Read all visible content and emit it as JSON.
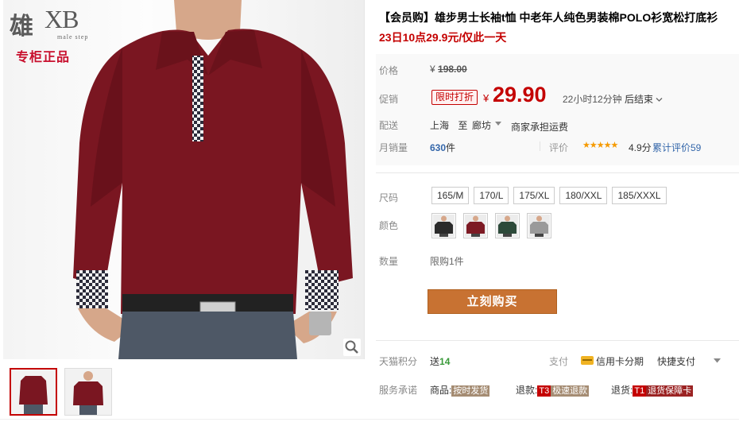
{
  "brand": {
    "logo_cn": "雄",
    "logo_en": "XB",
    "logo_sub": "male step",
    "authentic": "专柜正品"
  },
  "product": {
    "title": "【会员购】雄步男士长袖t恤 中老年人纯色男装棉POLO衫宽松打底衫",
    "subtitle": "23日10点29.9元/仅此一天"
  },
  "price": {
    "label": "价格",
    "currency": "¥",
    "original": "198.00"
  },
  "promo": {
    "label": "促销",
    "tag": "限时打折",
    "currency": "¥",
    "price": "29.90",
    "countdown": "22小时12分钟",
    "ends": "后结束"
  },
  "shipping": {
    "label": "配送",
    "from": "上海",
    "to_word": "至",
    "to_city": "廊坊",
    "note": "商家承担运费"
  },
  "sales": {
    "label": "月销量",
    "count": "630",
    "unit": "件",
    "rating_label": "评价",
    "stars": "★★★★★",
    "rating_value": "4.9分",
    "reviews": "累计评价59"
  },
  "sizes": {
    "label": "尺码",
    "options": [
      "165/M",
      "170/L",
      "175/XL",
      "180/XXL",
      "185/XXXL"
    ]
  },
  "colors": {
    "label": "颜色",
    "options": [
      {
        "name": "black",
        "hex": "#2b2b2b"
      },
      {
        "name": "wine-red",
        "hex": "#7d1a24"
      },
      {
        "name": "dark-green",
        "hex": "#2d4a3a"
      },
      {
        "name": "grey",
        "hex": "#9a9a9a"
      }
    ]
  },
  "quantity": {
    "label": "数量",
    "limit": "限购1件"
  },
  "buy_button": "立刻购买",
  "points": {
    "label": "天猫积分",
    "send": "送",
    "value": "14",
    "pay_label": "支付",
    "credit": "信用卡分期",
    "quick": "快捷支付"
  },
  "service": {
    "label": "服务承诺",
    "goods_prefix": "商品:",
    "goods_tag": "按时发货",
    "refund_prefix": "退款:",
    "refund_code": "T3",
    "refund_tag": "极速退款",
    "return_prefix": "退货:",
    "return_code": "T1",
    "return_tag": "退货保障卡"
  }
}
